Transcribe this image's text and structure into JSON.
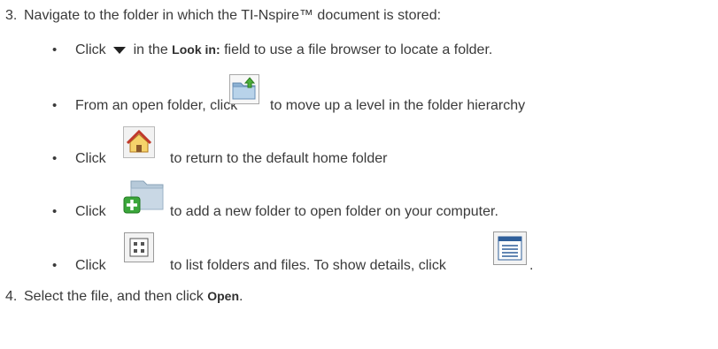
{
  "step3": {
    "number": "3.",
    "text": "Navigate to the folder in which the TI-Nspire™ document is stored:"
  },
  "bullets": [
    {
      "marker": "•",
      "pre": "Click",
      "bold": "Look in:",
      "mid": "in the",
      "post": "field to use a file browser to locate a folder.",
      "icon": "dropdown-triangle-icon"
    },
    {
      "marker": "•",
      "pre": "From an open folder, click",
      "post": "to move up a level in the folder hierarchy",
      "icon": "folder-up-icon"
    },
    {
      "marker": "•",
      "pre": "Click",
      "post": "to return to the default home folder",
      "icon": "home-icon"
    },
    {
      "marker": "•",
      "pre": "Click",
      "post": "to add a new folder to open folder on your computer.",
      "icon": "new-folder-icon"
    },
    {
      "marker": "•",
      "pre": "Click",
      "post": "to list folders and files. To show details, click",
      "end": ".",
      "icon": "list-view-icon",
      "icon2": "details-view-icon"
    }
  ],
  "step4": {
    "number": "4.",
    "text": "Select the file, and then click",
    "bold": "Open",
    "end": "."
  }
}
